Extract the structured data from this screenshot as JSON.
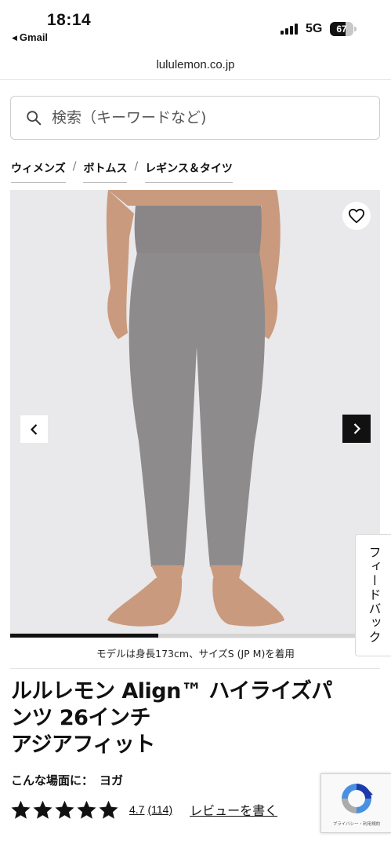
{
  "status_bar": {
    "time": "18:14",
    "back_app": "Gmail",
    "network": "5G",
    "battery_percent": 67
  },
  "browser": {
    "url": "lululemon.co.jp"
  },
  "search": {
    "placeholder": "検索（キーワードなど)"
  },
  "breadcrumb": {
    "items": [
      "ウィメンズ",
      "ボトムス",
      "レギンス＆タイツ"
    ],
    "separator": "/"
  },
  "gallery": {
    "image_progress": 0.4,
    "caption": "モデルは身長173cm、サイズS (JP M)を着用",
    "colors": {
      "background": "#e9e8ea",
      "fabric": "#8d8a8b",
      "skin": "#c99a7e"
    }
  },
  "feedback_tab": {
    "label": "フィードバック"
  },
  "product": {
    "title_lines": [
      "ルルレモン Align™ ハイライズパ",
      "ンツ 26インチ",
      "アジアフィット"
    ],
    "activity_label": "こんな場面に：",
    "activity_value": "ヨガ",
    "rating": 4.7,
    "stars": 5,
    "rating_text": "4.7",
    "review_count": "(114)",
    "write_review_label": "レビューを書く"
  },
  "recaptcha": {
    "legal_text": "プライバシー・利用規約"
  },
  "icons": {
    "search": "search-icon",
    "favorite": "heart-icon",
    "prev": "chevron-left-icon",
    "next": "chevron-right-icon",
    "star": "star-icon",
    "recaptcha": "recaptcha-logo"
  }
}
